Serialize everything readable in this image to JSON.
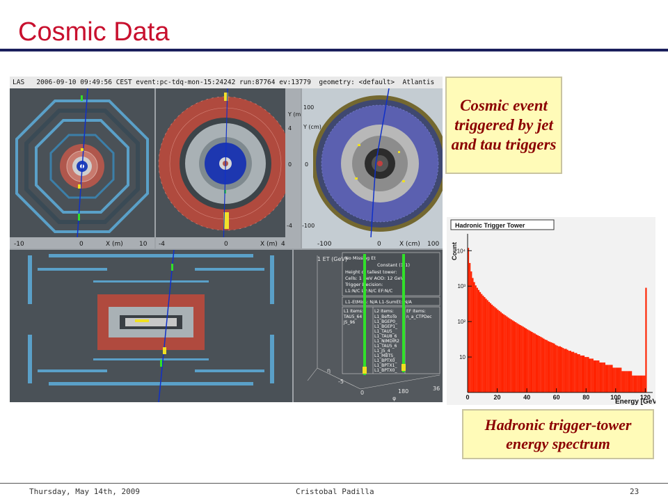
{
  "slide": {
    "title": "Cosmic Data",
    "footer_date": "Thursday, May 14th, 2009",
    "footer_author": "Cristobal Padilla",
    "footer_page": "23"
  },
  "event_display": {
    "header": "LAS   2006-09-10 09:49:56 CEST event:pc-tdq-mon-15:24242 run:87764 ev:13779  geometry: <default>  Atlantis",
    "yx_xlabel": "X (m)",
    "yx_ylabel": "Y (m)",
    "ticks_left": [
      "-10",
      "0",
      "10"
    ],
    "ticks_mid": [
      "-4",
      "0",
      "4"
    ],
    "ticks_right": [
      "-100",
      "0",
      "100"
    ],
    "ticks_mid_y": [
      "4",
      "0",
      "-4"
    ],
    "ticks_right_y": [
      "100",
      "0",
      "-100"
    ],
    "x_cm": "X (cm)",
    "y_cm": "Y (cm)",
    "lego_et": "1 ET (GeV)",
    "info_lines": [
      "No Missing Et",
      "Constant (1-1)",
      "Height of tallest tower:",
      "Cells: 1 GeV    AOD: 12 GeV",
      "Trigger Decision:",
      "L1:N/C L2:N/C EF:N/C"
    ],
    "l1_line": "L1-EtMiss: N/A  L1-SumEt: N/A",
    "l1_items_title": "L1 Items:",
    "l1_items": [
      "TAU5_64",
      "J5_96"
    ],
    "l2_items_title": "L2 Items:",
    "l2_items": [
      "L1_BeftoTo",
      "L1_BGEP0_",
      "L1_BGEP1_",
      "L1_TAU5_",
      "L1_TAU8_6",
      "L1_NIMDIR2",
      "L1_TAU5_6",
      "L1_J5_4",
      "L1_MBTS_",
      "L1_BPTX0_",
      "L1_BPTX1_",
      "L1_BPTX0_"
    ],
    "ef_items_title": "EF Items:",
    "ef_items": [
      "n_a_CTPDec"
    ],
    "eta_label": "η",
    "phi_label": "φ",
    "phi_ticks": [
      "0",
      "180",
      "36"
    ],
    "eta_ticks": [
      "-5",
      "0",
      "5"
    ]
  },
  "callouts": {
    "top": "Cosmic event triggered by jet and tau triggers",
    "bottom": "Hadronic trigger-tower energy spectrum"
  },
  "chart_data": {
    "type": "bar",
    "title": "Hadronic Trigger Tower",
    "xlabel": "Energy [GeV]",
    "ylabel": "Count",
    "xlim": [
      0,
      125
    ],
    "ylim": [
      1,
      30000
    ],
    "log_y": true,
    "y_ticks": [
      "10",
      "10²",
      "10³",
      "10⁴"
    ],
    "x_ticks": [
      "0",
      "20",
      "40",
      "60",
      "80",
      "100",
      "120"
    ],
    "bar_color": "#ff2200",
    "bin_width": 1,
    "x": [
      1,
      2,
      3,
      4,
      5,
      6,
      7,
      8,
      9,
      10,
      11,
      12,
      13,
      14,
      15,
      16,
      17,
      18,
      19,
      20,
      21,
      22,
      23,
      24,
      25,
      26,
      27,
      28,
      29,
      30,
      31,
      32,
      33,
      34,
      35,
      36,
      37,
      38,
      39,
      40,
      41,
      42,
      43,
      44,
      45,
      46,
      47,
      48,
      49,
      50,
      51,
      52,
      53,
      54,
      55,
      56,
      57,
      58,
      59,
      60,
      61,
      62,
      63,
      64,
      65,
      66,
      67,
      68,
      69,
      70,
      71,
      72,
      73,
      74,
      75,
      76,
      77,
      78,
      79,
      80,
      81,
      82,
      83,
      84,
      85,
      86,
      87,
      88,
      89,
      90,
      91,
      92,
      93,
      94,
      95,
      96,
      97,
      98,
      99,
      100,
      101,
      102,
      103,
      104,
      105,
      106,
      107,
      108,
      109,
      110,
      111,
      112,
      113,
      114,
      115,
      116,
      117,
      118,
      119,
      120,
      121
    ],
    "values": [
      12000,
      4500,
      2600,
      1700,
      1300,
      1050,
      900,
      780,
      680,
      600,
      540,
      490,
      440,
      400,
      360,
      330,
      300,
      275,
      255,
      235,
      215,
      200,
      185,
      170,
      160,
      150,
      140,
      130,
      122,
      115,
      108,
      102,
      96,
      90,
      85,
      80,
      76,
      72,
      68,
      64,
      60,
      57,
      54,
      51,
      48,
      46,
      43,
      41,
      39,
      37,
      35,
      33,
      31,
      30,
      28,
      27,
      26,
      25,
      24,
      22,
      21,
      20,
      20,
      19,
      18,
      17,
      17,
      16,
      15,
      15,
      14,
      14,
      13,
      13,
      12,
      12,
      11,
      11,
      11,
      10,
      10,
      10,
      9,
      9,
      9,
      8,
      8,
      8,
      8,
      7,
      7,
      7,
      7,
      6,
      6,
      6,
      6,
      6,
      5,
      5,
      5,
      5,
      5,
      5,
      4,
      4,
      4,
      4,
      4,
      4,
      4,
      3,
      3,
      3,
      3,
      3,
      3,
      3,
      3,
      3,
      900
    ]
  }
}
